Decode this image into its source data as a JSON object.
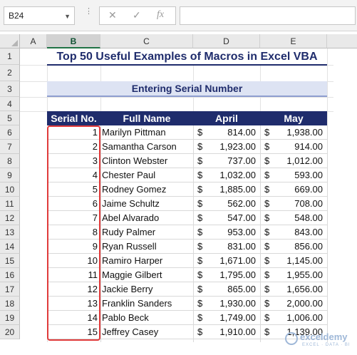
{
  "formula_bar": {
    "name_box": "B24",
    "cancel_icon": "✕",
    "confirm_icon": "✓",
    "fx_label": "fx",
    "formula": ""
  },
  "columns": [
    "A",
    "B",
    "C",
    "D",
    "E"
  ],
  "rows": [
    "1",
    "2",
    "3",
    "4",
    "5",
    "6",
    "7",
    "8",
    "9",
    "10",
    "11",
    "12",
    "13",
    "14",
    "15",
    "16",
    "17",
    "18",
    "19",
    "20"
  ],
  "title": "Top 50 Useful Examples of Macros in Excel VBA",
  "subtitle": "Entering Serial Number",
  "table": {
    "headers": [
      "Serial No.",
      "Full Name",
      "April",
      "May"
    ],
    "currency": "$",
    "rows": [
      {
        "serial": "1",
        "name": "Marilyn Pittman",
        "april": "814.00",
        "may": "1,938.00"
      },
      {
        "serial": "2",
        "name": "Samantha Carson",
        "april": "1,923.00",
        "may": "914.00"
      },
      {
        "serial": "3",
        "name": "Clinton Webster",
        "april": "737.00",
        "may": "1,012.00"
      },
      {
        "serial": "4",
        "name": "Chester Paul",
        "april": "1,032.00",
        "may": "593.00"
      },
      {
        "serial": "5",
        "name": "Rodney Gomez",
        "april": "1,885.00",
        "may": "669.00"
      },
      {
        "serial": "6",
        "name": "Jaime Schultz",
        "april": "562.00",
        "may": "708.00"
      },
      {
        "serial": "7",
        "name": "Abel Alvarado",
        "april": "547.00",
        "may": "548.00"
      },
      {
        "serial": "8",
        "name": "Rudy Palmer",
        "april": "953.00",
        "may": "843.00"
      },
      {
        "serial": "9",
        "name": "Ryan Russell",
        "april": "831.00",
        "may": "856.00"
      },
      {
        "serial": "10",
        "name": "Ramiro Harper",
        "april": "1,671.00",
        "may": "1,145.00"
      },
      {
        "serial": "11",
        "name": "Maggie Gilbert",
        "april": "1,795.00",
        "may": "1,955.00"
      },
      {
        "serial": "12",
        "name": "Jackie Berry",
        "april": "865.00",
        "may": "1,656.00"
      },
      {
        "serial": "13",
        "name": "Franklin Sanders",
        "april": "1,930.00",
        "may": "2,000.00"
      },
      {
        "serial": "14",
        "name": "Pablo Beck",
        "april": "1,749.00",
        "may": "1,006.00"
      },
      {
        "serial": "15",
        "name": "Jeffrey Casey",
        "april": "1,910.00",
        "may": "1,139.00"
      }
    ]
  },
  "watermark": {
    "name": "exceldemy",
    "tagline": "EXCEL · DATA · BI"
  },
  "colors": {
    "header_bg": "#1f2c6c",
    "subtitle_bg": "#dde3f3",
    "highlight_border": "#e03b3b",
    "selected_column": "#217346"
  }
}
